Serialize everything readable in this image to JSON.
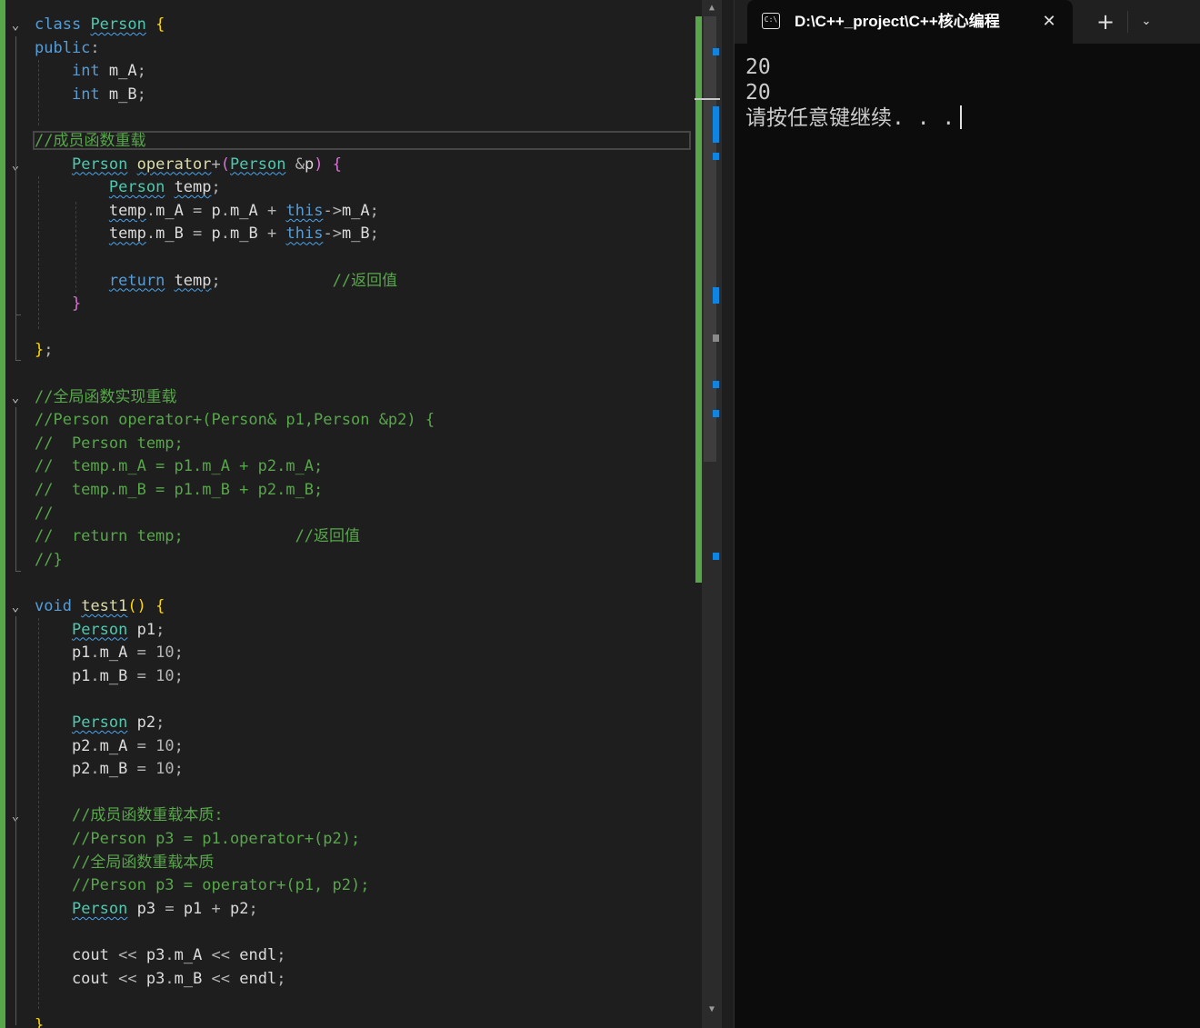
{
  "editor": {
    "lines": [
      {
        "fold": true,
        "text": "class Person {"
      },
      {
        "fold": false,
        "text": "public:"
      },
      {
        "fold": false,
        "text": "    int m_A;"
      },
      {
        "fold": false,
        "text": "    int m_B;"
      },
      {
        "fold": false,
        "text": ""
      },
      {
        "fold": false,
        "text": "//成员函数重载"
      },
      {
        "fold": true,
        "text": "    Person operator+(Person &p) {"
      },
      {
        "fold": false,
        "text": "        Person temp;"
      },
      {
        "fold": false,
        "text": "        temp.m_A = p.m_A + this->m_A;"
      },
      {
        "fold": false,
        "text": "        temp.m_B = p.m_B + this->m_B;"
      },
      {
        "fold": false,
        "text": ""
      },
      {
        "fold": false,
        "text": "        return temp;            //返回值"
      },
      {
        "fold": false,
        "text": "    }"
      },
      {
        "fold": false,
        "text": ""
      },
      {
        "fold": false,
        "text": "};"
      },
      {
        "fold": false,
        "text": ""
      },
      {
        "fold": true,
        "text": "//全局函数实现重载"
      },
      {
        "fold": false,
        "text": "//Person operator+(Person& p1,Person &p2) {"
      },
      {
        "fold": false,
        "text": "//  Person temp;"
      },
      {
        "fold": false,
        "text": "//  temp.m_A = p1.m_A + p2.m_A;"
      },
      {
        "fold": false,
        "text": "//  temp.m_B = p1.m_B + p2.m_B;"
      },
      {
        "fold": false,
        "text": "//"
      },
      {
        "fold": false,
        "text": "//  return temp;            //返回值"
      },
      {
        "fold": false,
        "text": "//}"
      },
      {
        "fold": false,
        "text": ""
      },
      {
        "fold": true,
        "text": "void test1() {"
      },
      {
        "fold": false,
        "text": "    Person p1;"
      },
      {
        "fold": false,
        "text": "    p1.m_A = 10;"
      },
      {
        "fold": false,
        "text": "    p1.m_B = 10;"
      },
      {
        "fold": false,
        "text": ""
      },
      {
        "fold": false,
        "text": "    Person p2;"
      },
      {
        "fold": false,
        "text": "    p2.m_A = 10;"
      },
      {
        "fold": false,
        "text": "    p2.m_B = 10;"
      },
      {
        "fold": false,
        "text": ""
      },
      {
        "fold": true,
        "text": "    //成员函数重载本质:"
      },
      {
        "fold": false,
        "text": "    //Person p3 = p1.operator+(p2);"
      },
      {
        "fold": false,
        "text": "    //全局函数重载本质"
      },
      {
        "fold": false,
        "text": "    //Person p3 = operator+(p1, p2);"
      },
      {
        "fold": false,
        "text": "    Person p3 = p1 + p2;"
      },
      {
        "fold": false,
        "text": ""
      },
      {
        "fold": false,
        "text": "    cout << p3.m_A << endl;"
      },
      {
        "fold": false,
        "text": "    cout << p3.m_B << endl;"
      },
      {
        "fold": false,
        "text": ""
      },
      {
        "fold": false,
        "text": "}"
      }
    ]
  },
  "terminal": {
    "tab_title": "D:\\C++_project\\C++核心编程",
    "tab_icon_text": "C:\\",
    "close_glyph": "✕",
    "new_tab_glyph": "+",
    "dropdown_glyph": "⌄",
    "output": [
      "20",
      "20",
      "请按任意键继续. . ."
    ]
  },
  "scrollbar": {
    "up_glyph": "▲",
    "down_glyph": "▼"
  },
  "colors": {
    "keyword": "#569cd6",
    "type": "#4ec9b0",
    "comment": "#57a64a",
    "function": "#dcdcaa",
    "change_margin": "#57a64a",
    "marker": "#0e85e3"
  }
}
